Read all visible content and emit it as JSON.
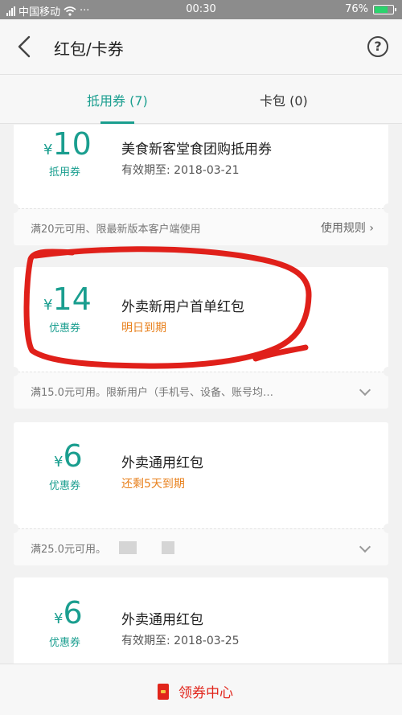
{
  "status_bar": {
    "carrier": "中国移动",
    "dots": "···",
    "time": "00:30",
    "battery": "76%",
    "battery_level": 0.76
  },
  "nav": {
    "back_icon": "chevron-left-icon",
    "title": "红包/卡券",
    "help_icon": "question-circle-icon",
    "help_glyph": "?"
  },
  "tabs": [
    {
      "label": "抵用券 (7)",
      "active": true
    },
    {
      "label": "卡包 (0)",
      "active": false
    }
  ],
  "coupons": [
    {
      "currency": "¥",
      "amount": "10",
      "type": "抵用券",
      "name": "美食新客堂食团购抵用券",
      "sub": "有效期至: 2018-03-21",
      "condition": "满20元可用、限最新版本客户端使用",
      "rule_link": "使用规则 ›"
    },
    {
      "currency": "¥",
      "amount": "14",
      "type": "优惠券",
      "name": "外卖新用户首单红包",
      "sub": "明日到期",
      "condition": "满15.0元可用。限新用户（手机号、设备、账号均…"
    },
    {
      "currency": "¥",
      "amount": "6",
      "type": "优惠券",
      "name": "外卖通用红包",
      "sub": "还剩5天到期",
      "condition": "满25.0元可用。"
    },
    {
      "currency": "¥",
      "amount": "6",
      "type": "优惠券",
      "name": "外卖通用红包",
      "sub": "有效期至: 2018-03-25"
    }
  ],
  "footer": {
    "label": "领券中心",
    "icon": "ticket-icon"
  },
  "colors": {
    "accent": "#1a9e8f",
    "warning": "#e8801c",
    "footer_red": "#e1251b",
    "annotation_red": "#e0201a"
  }
}
